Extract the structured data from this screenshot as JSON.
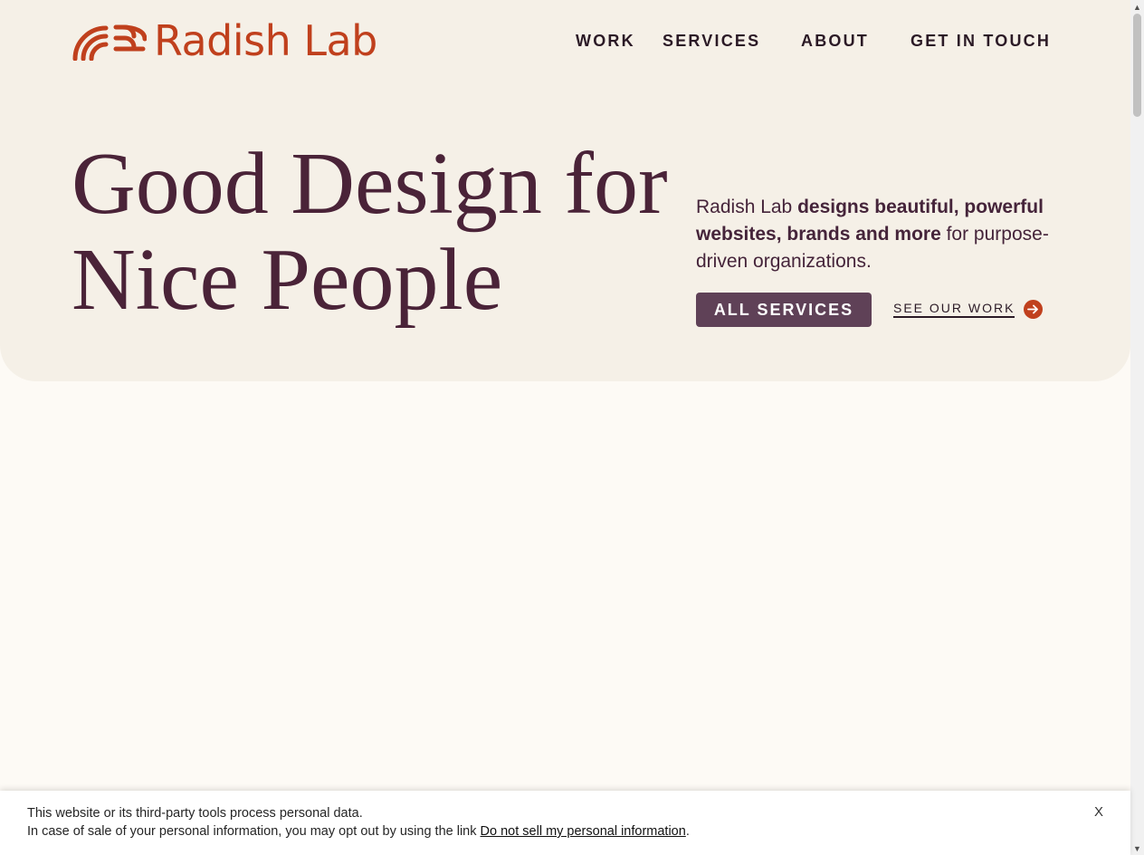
{
  "brand": {
    "name": "Radish Lab",
    "color": "#c0401d"
  },
  "nav": {
    "items": [
      "WORK",
      "SERVICES",
      "ABOUT",
      "GET IN TOUCH"
    ]
  },
  "hero": {
    "headline_line1": "Good Design for",
    "headline_line2": "Nice People",
    "intro_plain_1": "Radish Lab ",
    "intro_bold": "designs beautiful, powerful websites, brands and more",
    "intro_plain_2": " for purpose-driven organizations.",
    "primary_button": "ALL SERVICES",
    "secondary_link": "SEE OUR WORK",
    "background": "#f5f0e7",
    "headline_color": "#4a2338",
    "button_color": "#5f4157"
  },
  "cookie_banner": {
    "line1": "This website or its third-party tools process personal data.",
    "line2_prefix": "In case of sale of your personal information, you may opt out by using the link ",
    "link_text": "Do not sell my personal information",
    "line2_suffix": ".",
    "close_label": "X"
  },
  "icons": {
    "logo": "radish-lab-arcs-logo",
    "arrow": "arrow-right-circle-icon",
    "scroll_up": "triangle-up",
    "scroll_down": "triangle-down"
  }
}
